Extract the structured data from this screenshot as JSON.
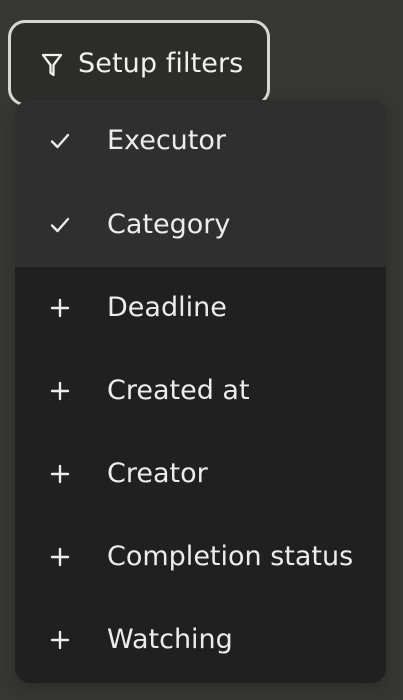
{
  "filters_button": {
    "label": "Setup filters",
    "icon": "filter-icon"
  },
  "menu": {
    "items": [
      {
        "label": "Executor",
        "icon": "checkmark-icon",
        "selected": true
      },
      {
        "label": "Category",
        "icon": "checkmark-icon",
        "selected": true
      },
      {
        "label": "Deadline",
        "icon": "plus-icon",
        "selected": false
      },
      {
        "label": "Created at",
        "icon": "plus-icon",
        "selected": false
      },
      {
        "label": "Creator",
        "icon": "plus-icon",
        "selected": false
      },
      {
        "label": "Completion status",
        "icon": "plus-icon",
        "selected": false
      },
      {
        "label": "Watching",
        "icon": "plus-icon",
        "selected": false
      }
    ]
  },
  "colors": {
    "background": "#363632",
    "menu_background": "#202020",
    "selected_item_background": "#2f2f2f",
    "text": "#ececea",
    "button_border": "#d7d7d2"
  }
}
